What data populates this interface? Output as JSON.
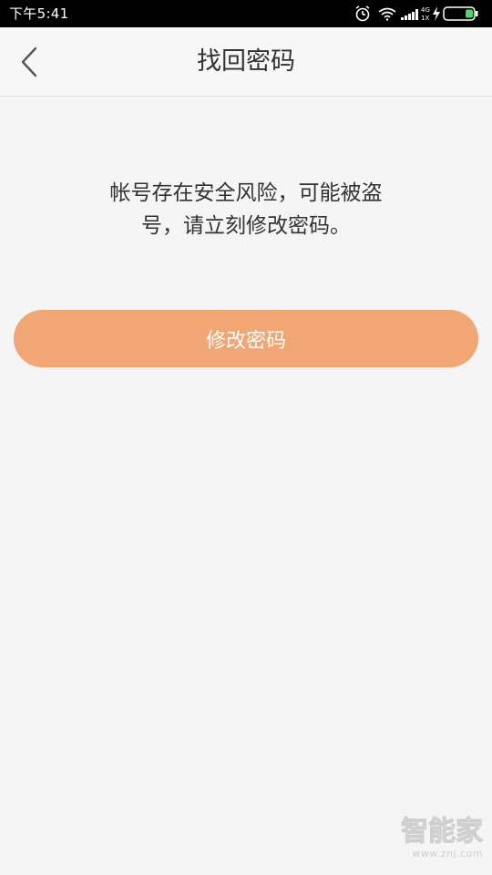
{
  "status_bar": {
    "time": "下午5:41",
    "network_type_top": "4G",
    "network_type_bottom": "1X"
  },
  "nav": {
    "title": "找回密码",
    "back_icon": "chevron-left-icon"
  },
  "content": {
    "warning_line1": "帐号存在安全风险，可能被盗",
    "warning_line2": "号，请立刻修改密码。",
    "change_password_label": "修改密码"
  },
  "watermark": {
    "brand": "智能家",
    "url": "www.znj.com"
  },
  "colors": {
    "button_bg": "#f2a673",
    "button_text": "#ffffff",
    "title_text": "#333333",
    "background": "#f5f5f5",
    "status_bar_bg": "#000000"
  }
}
